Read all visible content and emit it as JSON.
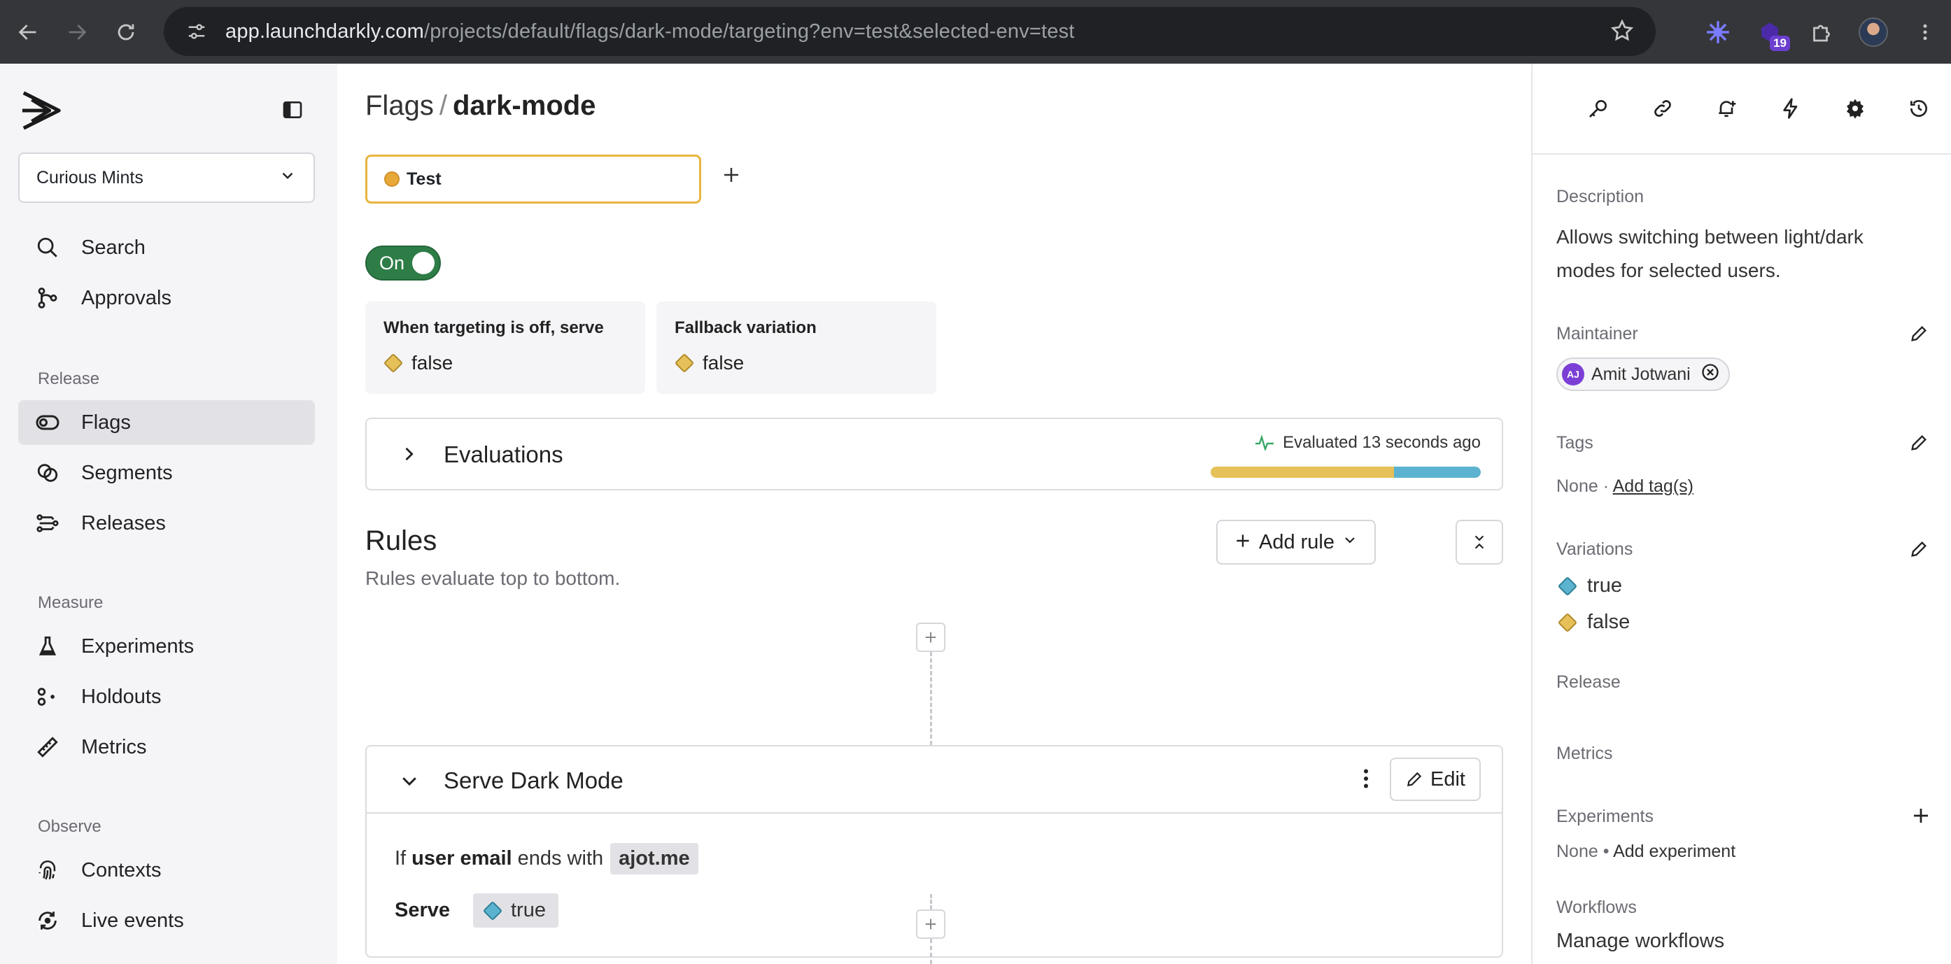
{
  "browser": {
    "url_host": "app.launchdarkly.com",
    "url_path": "/projects/default/flags/dark-mode/targeting?env=test&selected-env=test",
    "extension_badge": "19"
  },
  "sidebar": {
    "project": "Curious Mints",
    "top_items": [
      {
        "label": "Search",
        "icon": "search-icon"
      },
      {
        "label": "Approvals",
        "icon": "approvals-icon"
      }
    ],
    "sections": [
      {
        "label": "Release",
        "items": [
          {
            "label": "Flags",
            "icon": "flag-toggle-icon",
            "active": true
          },
          {
            "label": "Segments",
            "icon": "segments-icon"
          },
          {
            "label": "Releases",
            "icon": "releases-icon"
          }
        ]
      },
      {
        "label": "Measure",
        "items": [
          {
            "label": "Experiments",
            "icon": "flask-icon"
          },
          {
            "label": "Holdouts",
            "icon": "holdouts-icon"
          },
          {
            "label": "Metrics",
            "icon": "ruler-icon"
          }
        ]
      },
      {
        "label": "Observe",
        "items": [
          {
            "label": "Contexts",
            "icon": "fingerprint-icon"
          },
          {
            "label": "Live events",
            "icon": "live-events-icon"
          }
        ]
      }
    ]
  },
  "main": {
    "breadcrumb_root": "Flags",
    "breadcrumb_sep": "/",
    "flag_key": "dark-mode",
    "environment": "Test",
    "toggle_label": "On",
    "off_card": {
      "label": "When targeting is off, serve",
      "value": "false"
    },
    "fallback_card": {
      "label": "Fallback variation",
      "value": "false"
    },
    "evaluations": {
      "title": "Evaluations",
      "status": "Evaluated 13 seconds ago",
      "false_fraction": 0.68
    },
    "rules_title": "Rules",
    "rules_subtitle": "Rules evaluate top to bottom.",
    "add_rule_label": "Add rule",
    "rule": {
      "name": "Serve Dark Mode",
      "edit_label": "Edit",
      "clause_if": "If",
      "clause_attribute": "user email",
      "clause_operator": "ends with",
      "clause_value": "ajot.me",
      "serve_label": "Serve",
      "serve_value": "true"
    }
  },
  "right_panel": {
    "description_label": "Description",
    "description": "Allows switching between light/dark modes for selected users.",
    "maintainer_label": "Maintainer",
    "maintainer_initials": "AJ",
    "maintainer_name": "Amit Jotwani",
    "tags_label": "Tags",
    "tags_none": "None",
    "tags_dot": "·",
    "add_tags": "Add tag(s)",
    "variations_label": "Variations",
    "variations": [
      "true",
      "false"
    ],
    "release_label": "Release",
    "metrics_label": "Metrics",
    "experiments_label": "Experiments",
    "experiments_none": "None",
    "experiments_dot": "•",
    "add_experiment": "Add experiment",
    "workflows_label": "Workflows",
    "manage_workflows": "Manage workflows"
  },
  "colors": {
    "true_variation": "#5bb3cf",
    "false_variation": "#e6c059",
    "toggle_on": "#2e7d47",
    "env_test": "#e8a93b"
  }
}
